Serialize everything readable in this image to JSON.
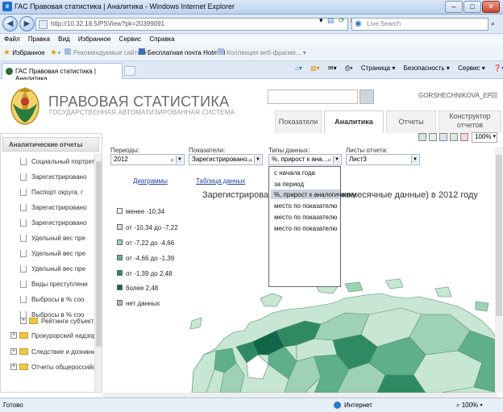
{
  "window": {
    "title": "ГАС Правовая статистика | Аналитика - Windows Internet Explorer"
  },
  "address": {
    "url": "http://10.32.18.5/PSView?pk=20399091",
    "search_placeholder": "Live Search"
  },
  "menu": [
    "Файл",
    "Правка",
    "Вид",
    "Избранное",
    "Сервис",
    "Справка"
  ],
  "favorites": {
    "label": "Избранное",
    "items": [
      "Рекомендуемые сайты ▾",
      "Бесплатная почта Hotmail",
      "Коллекция веб-фрагме... ▾"
    ]
  },
  "tab": {
    "title": "ГАС Правовая статистика | Аналитика"
  },
  "commandbar": [
    "Страница ▾",
    "Безопасность ▾",
    "Сервис ▾"
  ],
  "header": {
    "title": "ПРАВОВАЯ СТАТИСТИКА",
    "subtitle": "ГОСУДАРСТВЕННАЯ АВТОМАТИЗИРОВАННАЯ СИСТЕМА",
    "user": "GORSHECHNIKOVA_EP",
    "tabs": [
      "Показатели",
      "Аналитика",
      "Отчеты",
      "Конструктор отчетов"
    ]
  },
  "sidebar": {
    "title": "Аналитические отчеты",
    "items": [
      "Социальный портрет",
      "Зарегистрировано",
      "Паспорт округа, г",
      "Зарегистрировано",
      "Зарегистрировано",
      "Удельный вес пре",
      "Удельный вес пре",
      "Удельный вес пре",
      "Виды преступлени",
      "Выбросы в % соо",
      "Выбросы в % соо"
    ],
    "subgroup": "Рейтинги субъект",
    "groups": [
      "Прокурорский надзор",
      "Следствие и дознание",
      "Отчеты общероссийс"
    ]
  },
  "toolbar": {
    "zoom": "100%"
  },
  "filters": {
    "periods": {
      "label": "Периоды:",
      "value": "2012"
    },
    "indicators": {
      "label": "Показатели:",
      "value": "Зарегистрировано..."
    },
    "datatypes": {
      "label": "Типы данных:",
      "value": "%, прирост к ана..."
    },
    "sheets": {
      "label": "Листы отчета:",
      "value": "Лист3"
    }
  },
  "links": {
    "diagrams": "Диаграммы",
    "table": "Таблица данных"
  },
  "map": {
    "title_left": "Зарегистрирова",
    "title_right": "жемесячные данные) в 2012 году"
  },
  "legend": [
    {
      "label": "менее -10,34",
      "color": "#ffffff"
    },
    {
      "label": "от -10,34 до -7,22",
      "color": "#c8e6d4"
    },
    {
      "label": "от -7,22 до -4,66",
      "color": "#9fd2b4"
    },
    {
      "label": "от -4,66 до -1,39",
      "color": "#5fb08a"
    },
    {
      "label": "от -1,39 до 2,48",
      "color": "#2f8a64"
    },
    {
      "label": "более 2,48",
      "color": "#11664a"
    },
    {
      "label": "нет данных",
      "color": "#b8b8b8"
    }
  ],
  "dropdown": {
    "options": [
      "с начала года",
      "за период",
      "%, прирост к аналогичному",
      "место по показателю",
      "место по показателю",
      "место по показателю"
    ],
    "selected_index": 2
  },
  "status": {
    "left": "Готово",
    "zone": "Интернет",
    "zoom": "100%"
  }
}
